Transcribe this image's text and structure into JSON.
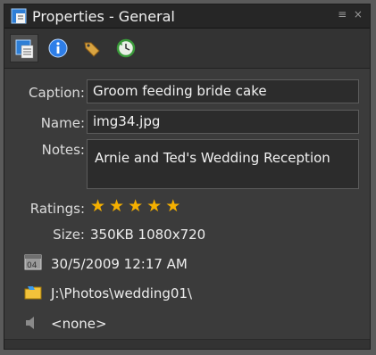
{
  "window": {
    "title": "Properties - General",
    "controls": "≡ ×"
  },
  "toolbar": {
    "buttons": [
      {
        "icon": "properties-page-icon",
        "active": true
      },
      {
        "icon": "info-icon",
        "active": false
      },
      {
        "icon": "tag-icon",
        "active": false
      },
      {
        "icon": "refresh-clock-icon",
        "active": false
      }
    ]
  },
  "fields": {
    "caption_label": "Caption:",
    "caption_value": "Groom feeding bride cake",
    "name_label": "Name:",
    "name_value": "img34.jpg",
    "notes_label": "Notes:",
    "notes_value": "Arnie and Ted's Wedding  Reception"
  },
  "info": {
    "ratings_label": "Ratings:",
    "rating": 5,
    "size_label": "Size:",
    "size_value": "350KB  1080x720",
    "date_value": "30/5/2009 12:17 AM",
    "path_value": "J:\\Photos\\wedding01\\",
    "audio_value": "<none>"
  },
  "colors": {
    "star": "#f5b000",
    "panel_bg": "#3b3b3b",
    "titlebar_bg": "#262626"
  }
}
